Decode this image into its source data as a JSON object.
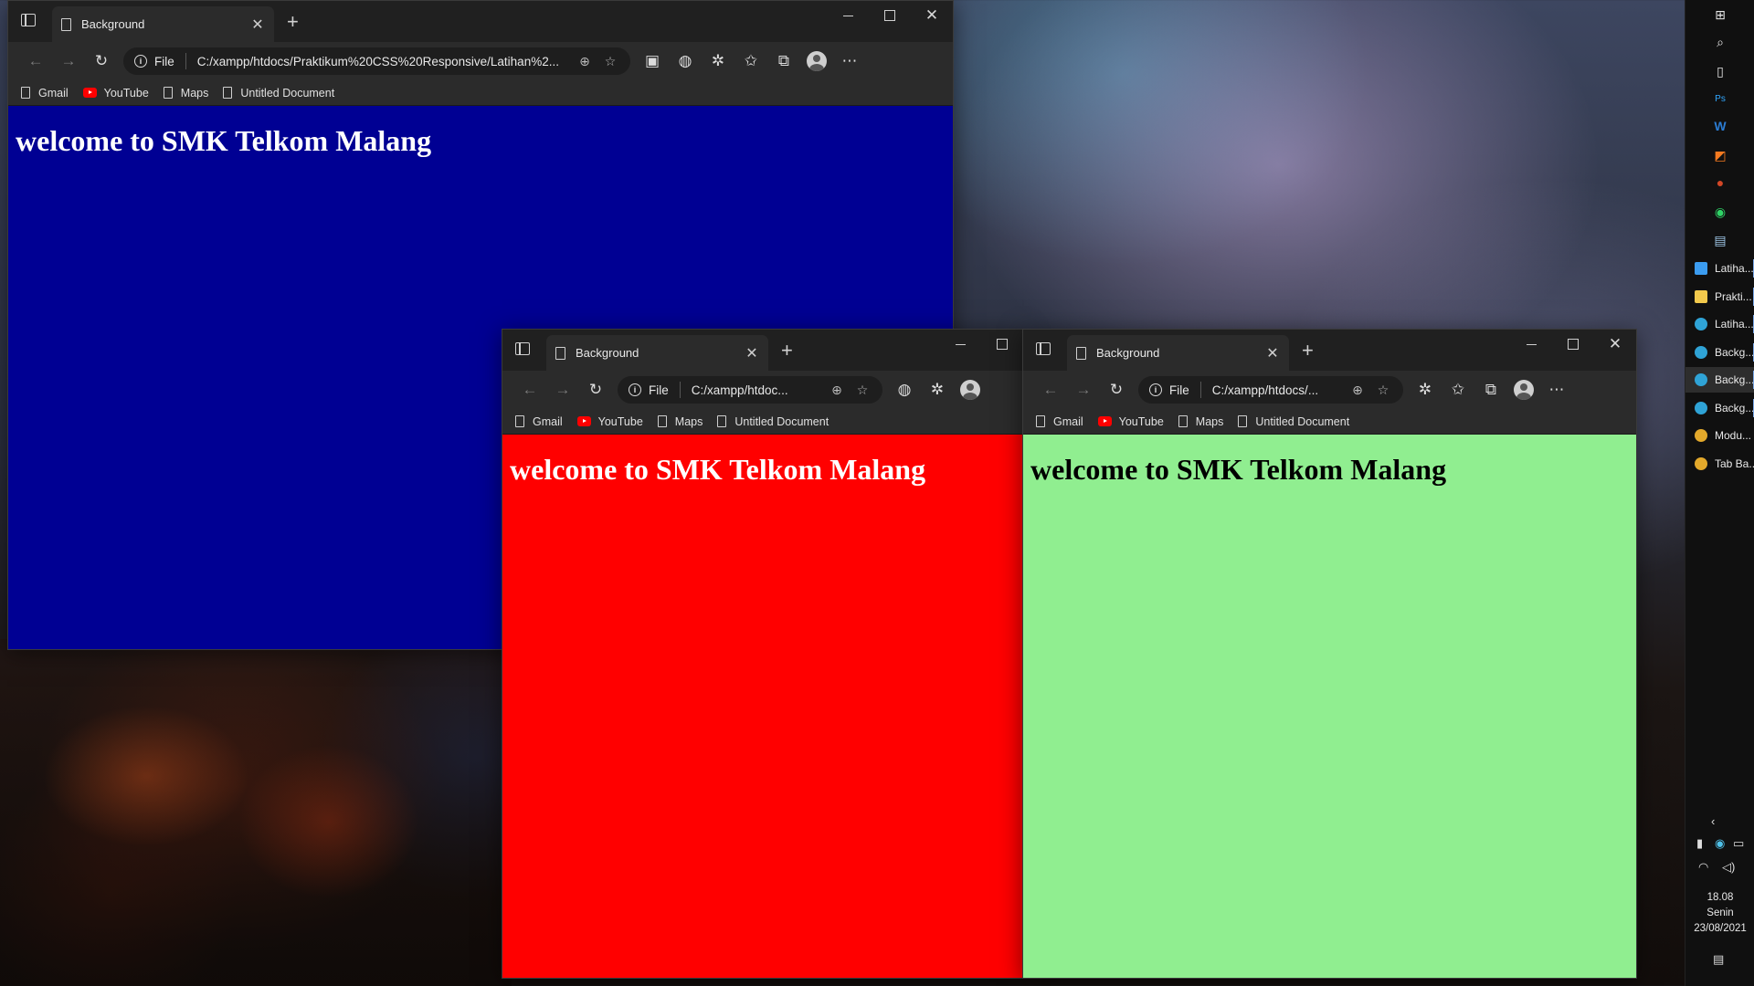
{
  "windows": [
    {
      "id": "blue",
      "tab_title": "Background",
      "address_label": "File",
      "url": "C:/xampp/htdocs/Praktikum%20CSS%20Responsive/Latihan%2...",
      "heading": "welcome to SMK Telkom Malang",
      "page_color": "#000093",
      "text_color": "#ffffff"
    },
    {
      "id": "red",
      "tab_title": "Background",
      "address_label": "File",
      "url": "C:/xampp/htdoc...",
      "heading": "welcome to SMK Telkom Malang",
      "page_color": "#ff0000",
      "text_color": "#ffffff"
    },
    {
      "id": "green",
      "tab_title": "Background",
      "address_label": "File",
      "url": "C:/xampp/htdocs/...",
      "heading": "welcome to SMK Telkom Malang",
      "page_color": "#90ee90",
      "text_color": "#000000"
    }
  ],
  "bookmarks": [
    {
      "label": "Gmail",
      "icon": "document-icon"
    },
    {
      "label": "YouTube",
      "icon": "youtube-icon"
    },
    {
      "label": "Maps",
      "icon": "document-icon"
    },
    {
      "label": "Untitled Document",
      "icon": "document-icon"
    }
  ],
  "taskbar": {
    "apps": [
      {
        "label": "Latiha...",
        "icon": "vscode-icon",
        "color": "#3b9cf0"
      },
      {
        "label": "Prakti...",
        "icon": "folder-icon",
        "color": "#f2c94c"
      },
      {
        "label": "Latiha...",
        "icon": "edge-icon",
        "color": "#2fa3d6"
      },
      {
        "label": "Backg...",
        "icon": "edge-icon",
        "color": "#2fa3d6"
      },
      {
        "label": "Backg...",
        "icon": "edge-icon",
        "color": "#2fa3d6"
      },
      {
        "label": "Backg...",
        "icon": "edge-icon",
        "color": "#2fa3d6"
      },
      {
        "label": "Modu...",
        "icon": "chrome-icon",
        "color": "#e3a92b"
      },
      {
        "label": "Tab Ba...",
        "icon": "chrome-icon",
        "color": "#e3a92b"
      }
    ],
    "clock": {
      "time": "18.08",
      "day": "Senin",
      "date": "23/08/2021"
    }
  }
}
